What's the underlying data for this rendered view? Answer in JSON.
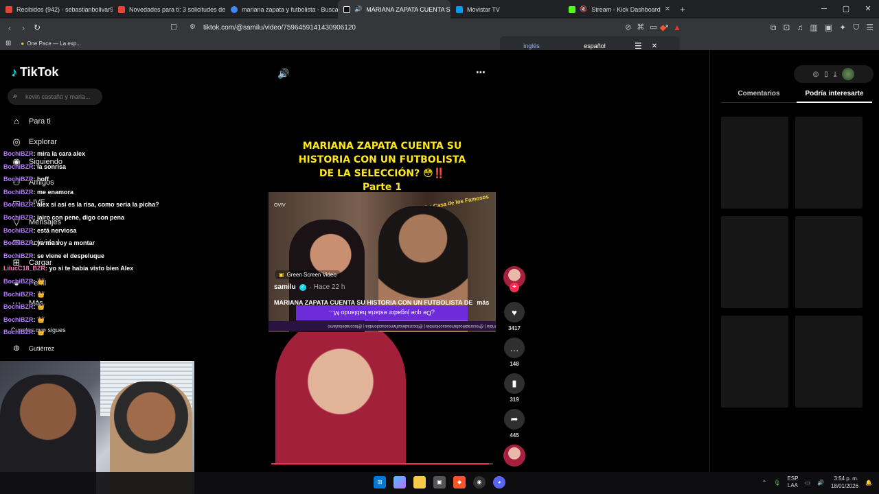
{
  "tabs": [
    {
      "label": "Recibidos (942) - sebastianbolivar90",
      "color": "#ea4335"
    },
    {
      "label": "Novedades para ti: 3 solicitudes de a",
      "color": "#ea4335"
    },
    {
      "label": "mariana zapata y futbolista - Buscar",
      "color": "#4285f4"
    },
    {
      "label": "MARIANA ZAPATA CUENTA S",
      "color": "#ffffff"
    },
    {
      "label": "Movistar TV",
      "color": "#019df4"
    },
    {
      "label": "Stream - Kick Dashboard",
      "color": "#53fc18"
    }
  ],
  "browser": {
    "url": "tiktok.com/@samilu/video/7596459141430906120",
    "bookmark": "One Pace — La exp..."
  },
  "translate": {
    "lang1": "inglés",
    "lang2": "español"
  },
  "tiktok": {
    "logo": "TikTok",
    "search_placeholder": "kevin castaño y maria...",
    "nav": [
      "Para ti",
      "Explorar",
      "Siguiendo",
      "Amigos",
      "LIVE",
      "Mensajes",
      "Actividad",
      "Cargar",
      "Perfil",
      "Más"
    ],
    "following_header": "Cuentas que sigues",
    "following_account": "Gutiérrez"
  },
  "chat": [
    {
      "user": "BochiBZR",
      "msg": ": mira la cara alex"
    },
    {
      "user": "BochiBZR",
      "msg": ": la sonrisa"
    },
    {
      "user": "BochiBZR",
      "msg": ": hoff"
    },
    {
      "user": "BochiBZR",
      "msg": ": me enamora"
    },
    {
      "user": "BochiBZR",
      "msg": ": alex si así es la risa, como seria la picha?"
    },
    {
      "user": "BochiBZR",
      "msg": ": jairo con pene, digo con pena"
    },
    {
      "user": "BochiBZR",
      "msg": ": está nerviosa"
    },
    {
      "user": "BochiBZR",
      "msg": ": ya me voy a montar"
    },
    {
      "user": "BochiBZR",
      "msg": ": se viene el despeluque"
    },
    {
      "user": "LilucC18_BZR",
      "msg": ": yo si te había visto bien Alex"
    },
    {
      "user": "BochiBZR",
      "msg": ": 👑"
    },
    {
      "user": "BochiBZR",
      "msg": ": 👑"
    },
    {
      "user": "BochiBZR",
      "msg": ": 👑"
    },
    {
      "user": "BochiBZR",
      "msg": ": 👑"
    },
    {
      "user": "BochiBZR",
      "msg": ": 👑"
    }
  ],
  "video": {
    "title_lines": [
      "MARIANA ZAPATA CUENTA SU",
      "HISTORIA CON UN FUTBOLISTA",
      "DE LA SELECCIÓN? 😳‼️"
    ],
    "part": "Parte 1",
    "scene_banner": "¿De que jugador estaría hablando M...",
    "scene_ticker": "mbia | @locoradelosfamososcolombia | @locoradelosfamososcolombia | @locoradelosfamo",
    "watermark": "OVIV",
    "corner_logo": "La Casa de los Famosos",
    "green_screen": "Green Screen Video",
    "author": "samilu",
    "when": "· Hace 22 h",
    "caption": "MARIANA ZAPATA CUENTA SU HISTORIA CON UN FUTBOLISTA DE",
    "more": "más",
    "progress": 0.98
  },
  "actions": {
    "likes": "3417",
    "comments": "148",
    "saves": "319",
    "shares": "445"
  },
  "rightpanel": {
    "tab1": "Comentarios",
    "tab2": "Podría interesarte"
  },
  "taskbar": {
    "lang": "ESP",
    "region": "LAA",
    "time": "3:54 p. m.",
    "date": "18/01/2026"
  }
}
